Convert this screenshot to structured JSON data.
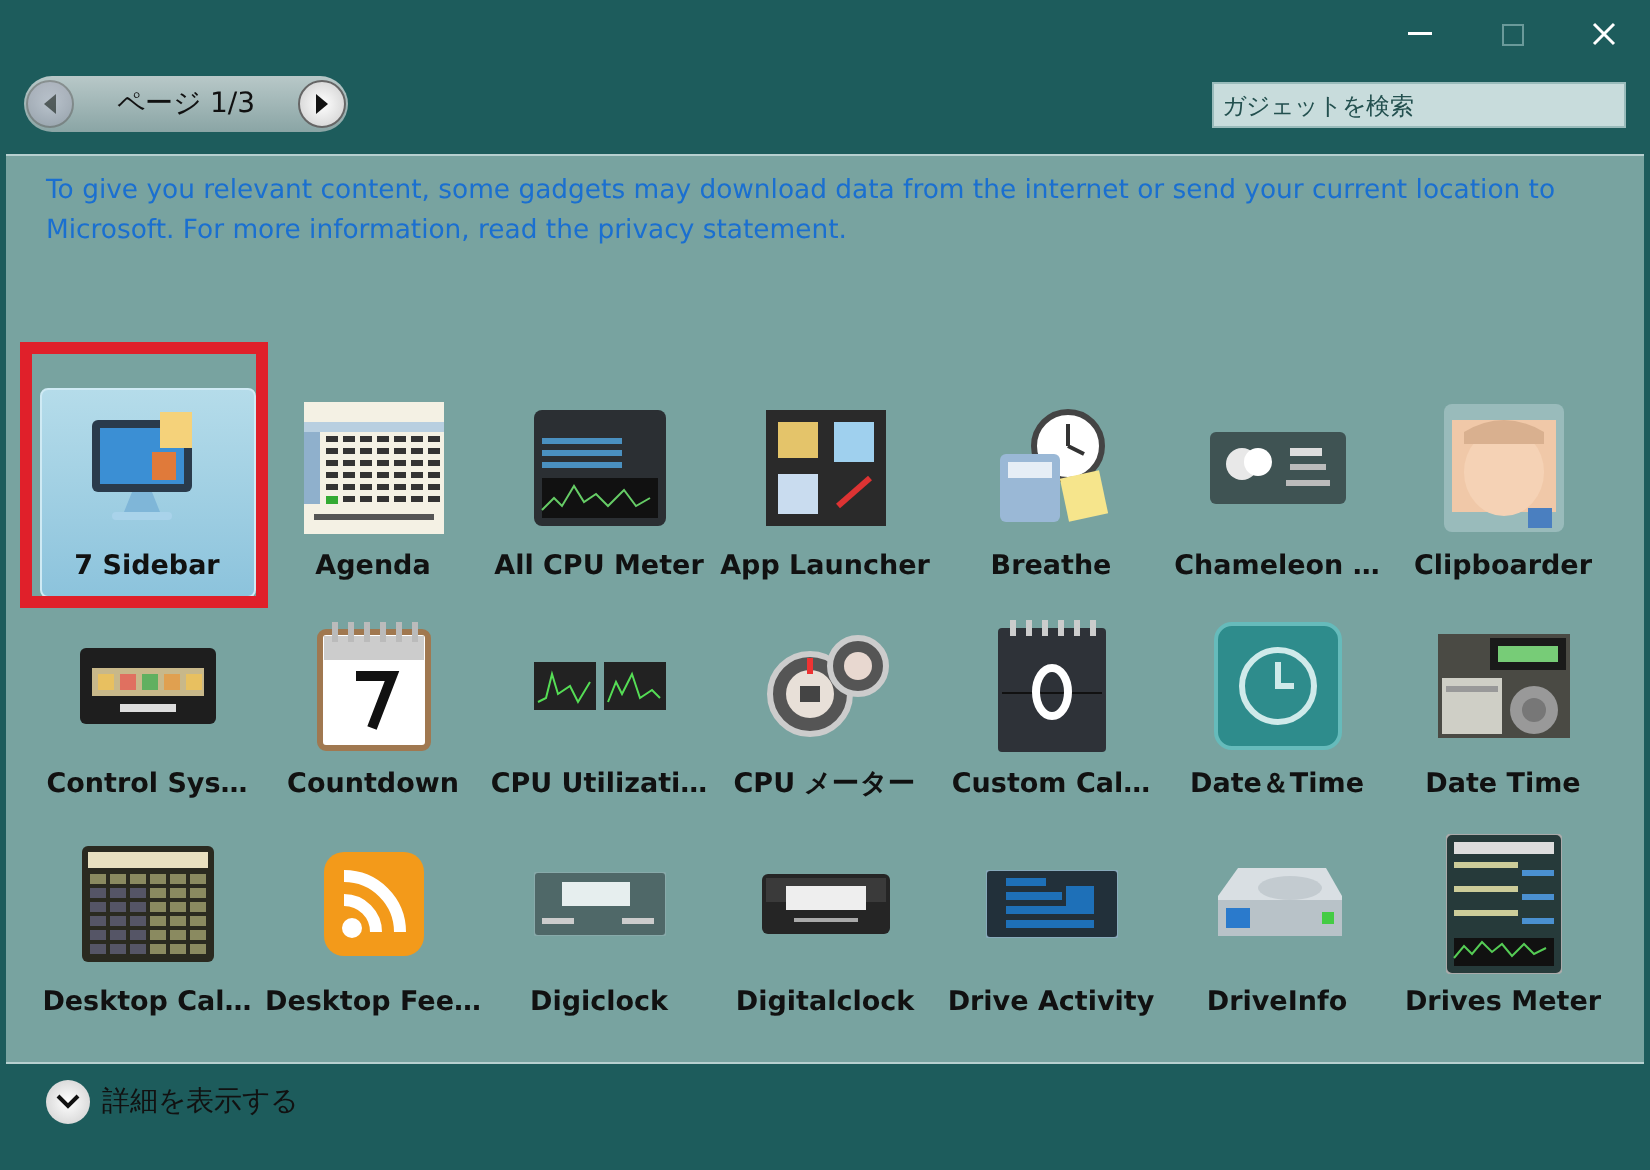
{
  "pager": {
    "label": "ページ 1/3",
    "prev_disabled": true,
    "next_disabled": false
  },
  "search": {
    "placeholder": "ガジェットを検索"
  },
  "notice": "To give you relevant content, some gadgets may download data from the internet or send your current location to Microsoft. For more information, read the privacy statement.",
  "gadgets": [
    {
      "name": "7 Sidebar",
      "kind": "monitor",
      "selected": true,
      "annotated": true
    },
    {
      "name": "Agenda",
      "kind": "calendar",
      "selected": false,
      "annotated": false
    },
    {
      "name": "All CPU Meter",
      "kind": "meter",
      "selected": false,
      "annotated": false
    },
    {
      "name": "App Launcher",
      "kind": "launcher",
      "selected": false,
      "annotated": false
    },
    {
      "name": "Breathe",
      "kind": "clock",
      "selected": false,
      "annotated": false
    },
    {
      "name": "Chameleon …",
      "kind": "weather",
      "selected": false,
      "annotated": false
    },
    {
      "name": "Clipboarder",
      "selected": false,
      "annotated": false
    },
    {
      "name": "Control Sys…",
      "kind": "buttons",
      "selected": false,
      "annotated": false
    },
    {
      "name": "Countdown",
      "kind": "pagecal",
      "selected": false,
      "annotated": false
    },
    {
      "name": "CPU Utilizati…",
      "kind": "graphs",
      "selected": false,
      "annotated": false
    },
    {
      "name": "CPU メーター",
      "kind": "gauge",
      "selected": false,
      "annotated": false
    },
    {
      "name": "Custom Cal…",
      "kind": "darkcal",
      "selected": false,
      "annotated": false
    },
    {
      "name": "Date＆Time",
      "kind": "tileclock",
      "selected": false,
      "annotated": false
    },
    {
      "name": "Date Time",
      "kind": "radio",
      "selected": false,
      "annotated": false
    },
    {
      "name": "Desktop Cal…",
      "kind": "calculator",
      "selected": false,
      "annotated": false
    },
    {
      "name": "Desktop Fee…",
      "kind": "rss",
      "selected": false,
      "annotated": false
    },
    {
      "name": "Digiclock",
      "kind": "digital",
      "selected": false,
      "annotated": false
    },
    {
      "name": "Digitalclock",
      "kind": "digital2",
      "selected": false,
      "annotated": false
    },
    {
      "name": "Drive Activity",
      "kind": "activity",
      "selected": false,
      "annotated": false
    },
    {
      "name": "DriveInfo",
      "kind": "drive",
      "selected": false,
      "annotated": false
    },
    {
      "name": "Drives Meter",
      "kind": "drivesmeter",
      "selected": false,
      "annotated": false
    }
  ],
  "details_toggle": {
    "label": "詳細を表示する",
    "expanded": false
  }
}
